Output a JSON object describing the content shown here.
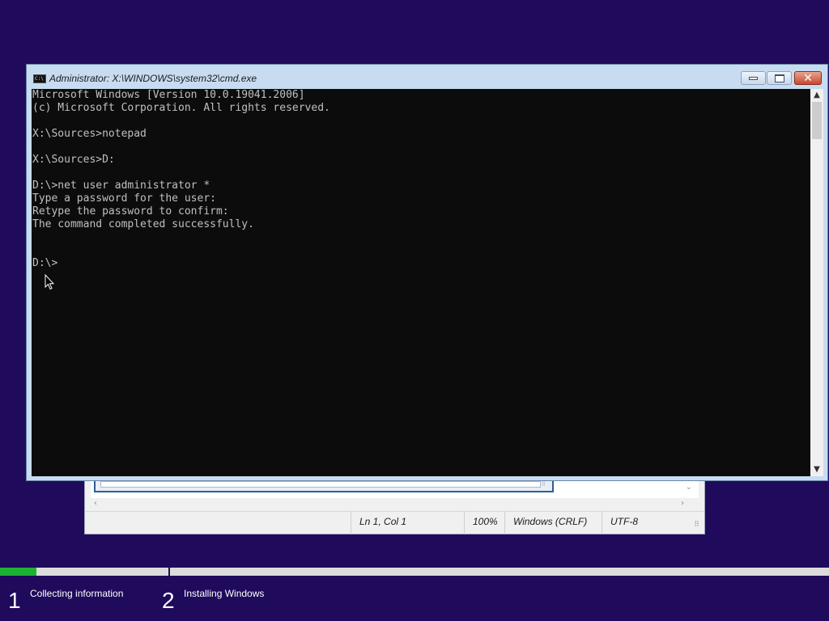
{
  "cmd": {
    "title": "Administrator: X:\\WINDOWS\\system32\\cmd.exe",
    "icon_text": "C:\\",
    "lines": [
      "Microsoft Windows [Version 10.0.19041.2006]",
      "(c) Microsoft Corporation. All rights reserved.",
      "",
      "X:\\Sources>notepad",
      "",
      "X:\\Sources>D:",
      "",
      "D:\\>net user administrator *",
      "Type a password for the user:",
      "Retype the password to confirm:",
      "The command completed successfully.",
      "",
      "",
      "D:\\>"
    ],
    "controls": {
      "minimize": "minimize-icon",
      "maximize": "maximize-icon",
      "close": "close-icon",
      "close_glyph": "✕"
    },
    "colors": {
      "background": "#0c0c0c",
      "text": "#c0c0c0",
      "frame": "#c7dcf1"
    }
  },
  "notepad": {
    "status": {
      "position": "Ln 1, Col 1",
      "zoom": "100%",
      "line_ending": "Windows (CRLF)",
      "encoding": "UTF-8"
    }
  },
  "setup": {
    "progress_fraction": 0.044,
    "steps": [
      {
        "number": "1",
        "label": "Collecting information"
      },
      {
        "number": "2",
        "label": "Installing Windows"
      }
    ],
    "colors": {
      "background": "#1f0a5c",
      "progress": "#1db233"
    }
  }
}
